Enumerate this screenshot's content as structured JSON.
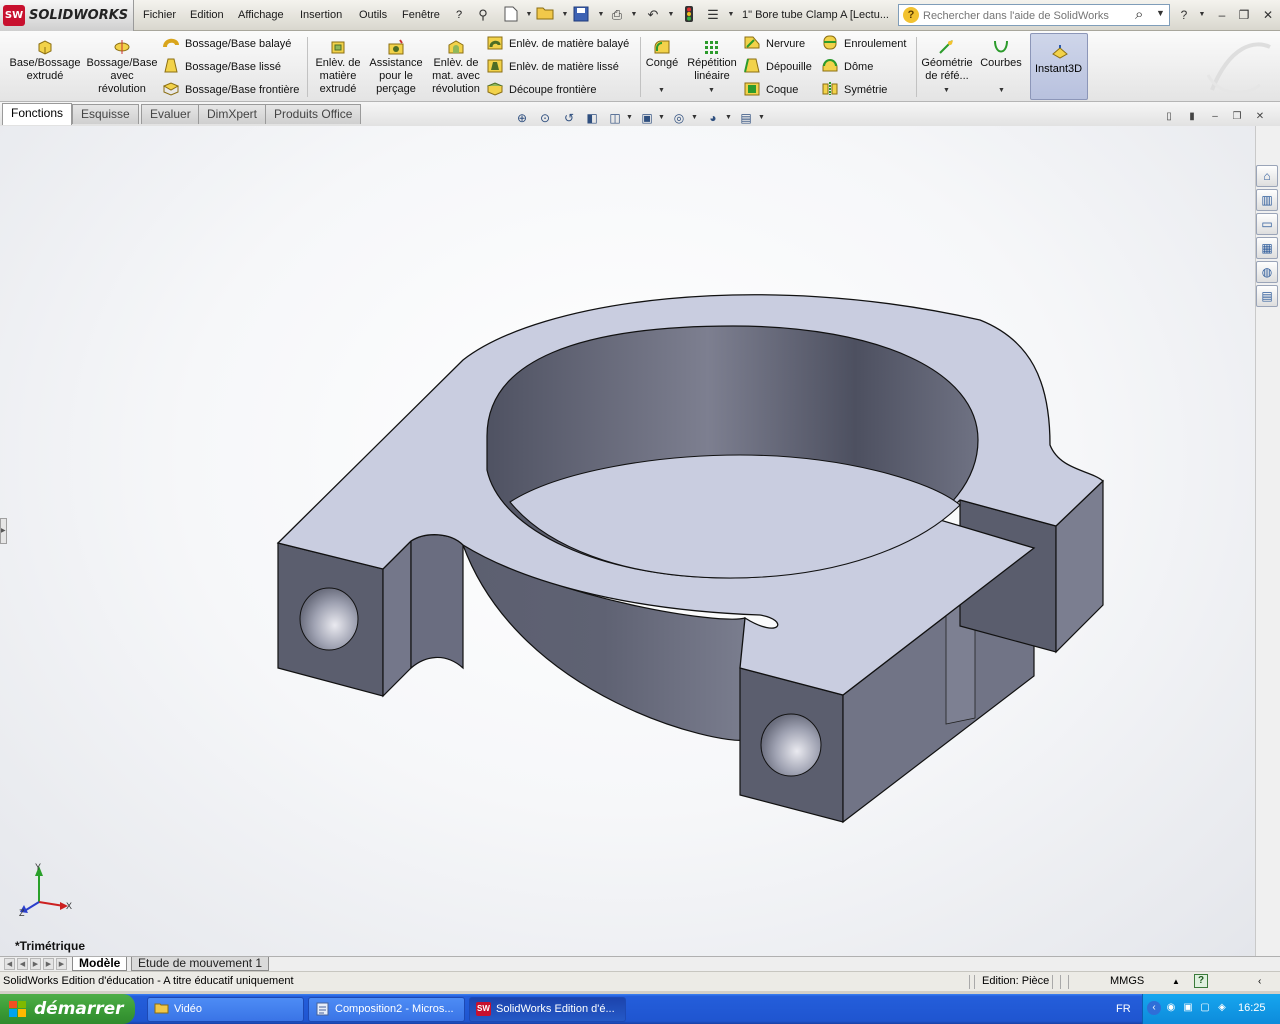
{
  "app": {
    "brand": "SOLIDWORKS",
    "logo_badge": "SW",
    "document_title": "1\" Bore tube Clamp A [Lectu..."
  },
  "menu": [
    "Fichier",
    "Edition",
    "Affichage",
    "Insertion",
    "Outils",
    "Fenêtre",
    "?"
  ],
  "search": {
    "placeholder": "Rechercher dans l'aide de SolidWorks"
  },
  "commands": {
    "extrude_boss": "Base/Bossage extrudé",
    "revolve_boss": "Bossage/Base avec révolution",
    "swept_boss": "Bossage/Base balayé",
    "lofted_boss": "Bossage/Base lissé",
    "boundary_boss": "Bossage/Base frontière",
    "extruded_cut": "Enlèv. de matière extrudé",
    "hole_wizard": "Assistance pour le perçage",
    "revolved_cut": "Enlèv. de mat. avec révolution",
    "swept_cut": "Enlèv. de matière balayé",
    "lofted_cut": "Enlèv. de matière lissé",
    "boundary_cut": "Découpe frontière",
    "fillet": "Congé",
    "linear_pattern": "Répétition linéaire",
    "rib": "Nervure",
    "draft": "Dépouille",
    "shell": "Coque",
    "wrap": "Enroulement",
    "dome": "Dôme",
    "mirror": "Symétrie",
    "ref_geometry": "Géométrie de réfé...",
    "curves": "Courbes",
    "instant3d": "Instant3D"
  },
  "tabs": [
    "Fonctions",
    "Esquisse",
    "Evaluer",
    "DimXpert",
    "Produits Office"
  ],
  "active_tab": "Fonctions",
  "viewport": {
    "view_name": "*Trimétrique",
    "triad_x": "X",
    "triad_y": "Y",
    "triad_z": "Z",
    "model_fill": "#c9cde0",
    "model_dark": "#5e6170"
  },
  "model_tabs": [
    "Modèle",
    "Etude de mouvement 1"
  ],
  "status": {
    "message": "SolidWorks Edition d'éducation - A titre éducatif uniquement",
    "mode": "Edition: Pièce",
    "units": "MMGS"
  },
  "taskbar": {
    "start": "démarrer",
    "tasks": [
      "Vidéo",
      "Composition2 - Micros...",
      "SolidWorks Edition d'é..."
    ],
    "language": "FR",
    "clock": "16:25"
  },
  "colors": {
    "accent_red": "#c8102e",
    "taskbar_blue": "#245edb",
    "start_green": "#3c9d37"
  }
}
